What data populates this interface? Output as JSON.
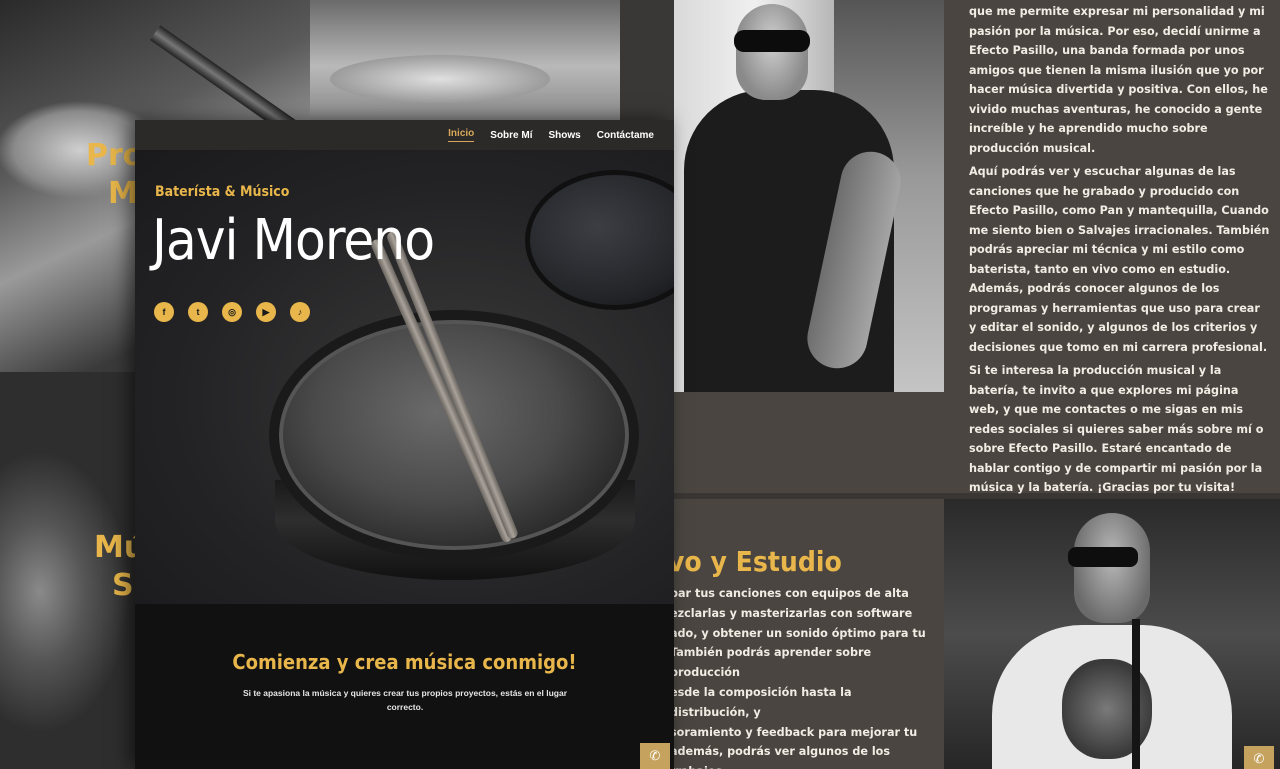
{
  "background": {
    "panel_texts": [
      "Prod",
      "Mú",
      "Mús",
      "Se"
    ]
  },
  "main": {
    "nav": [
      "Inicio",
      "Sobre Mí",
      "Shows",
      "Contáctame"
    ],
    "tagline": "Baterísta & Músico",
    "title": "Javi Moreno",
    "social_icons": [
      "facebook-icon",
      "twitter-icon",
      "instagram-icon",
      "youtube-icon",
      "tiktok-icon"
    ],
    "cta_title": "Comienza y crea música conmigo!",
    "cta_text": "Si te apasiona la música y quieres crear tus propios proyectos, estás en el lugar correcto."
  },
  "about": {
    "paragraphs": [
      "que me permite expresar mi personalidad y mi pasión por la música. Por eso, decidí unirme a Efecto Pasillo, una banda formada por unos amigos que tienen la misma ilusión que yo por hacer música divertida y positiva. Con ellos, he vivido muchas aventuras, he conocido a gente increíble y he aprendido mucho sobre producción musical.",
      "Aquí podrás ver y escuchar algunas de las canciones que he grabado y producido con Efecto Pasillo, como Pan y mantequilla, Cuando me siento bien o Salvajes irracionales. También podrás apreciar mi técnica y mi estilo como baterista, tanto en vivo como en estudio. Además, podrás conocer algunos de los programas y herramientas que uso para crear y editar el sonido, y algunos de los criterios y decisiones que tomo en mi carrera profesional.",
      "Si te interesa la producción musical y la batería, te invito a que explores mi página web, y que me contactes o me sigas en mis redes sociales si quieres saber más sobre mí o sobre Efecto Pasillo. Estaré encantado de hablar contigo y de compartir mi pasión por la música y la batería. ¡Gracias por tu visita!"
    ]
  },
  "studio": {
    "heading": "vo y Estudio",
    "text": "bar tus canciones con equipos de alta\nezclarlas y masterizarlas con software\nado, y obtener un sonido óptimo para tu\nTambién podrás aprender sobre producción\nesde la composición hasta la distribución, y\nsoramiento y feedback para mejorar tu\nademás, podrás ver algunos de los trabajos\nlizado con otros artistas, y escuchar cómo\ns canciones en vivo y en estudio. Si estás"
  },
  "colors": {
    "accent": "#e8b64a",
    "page_bg": "#4a4540",
    "dark_bg": "#111111"
  }
}
